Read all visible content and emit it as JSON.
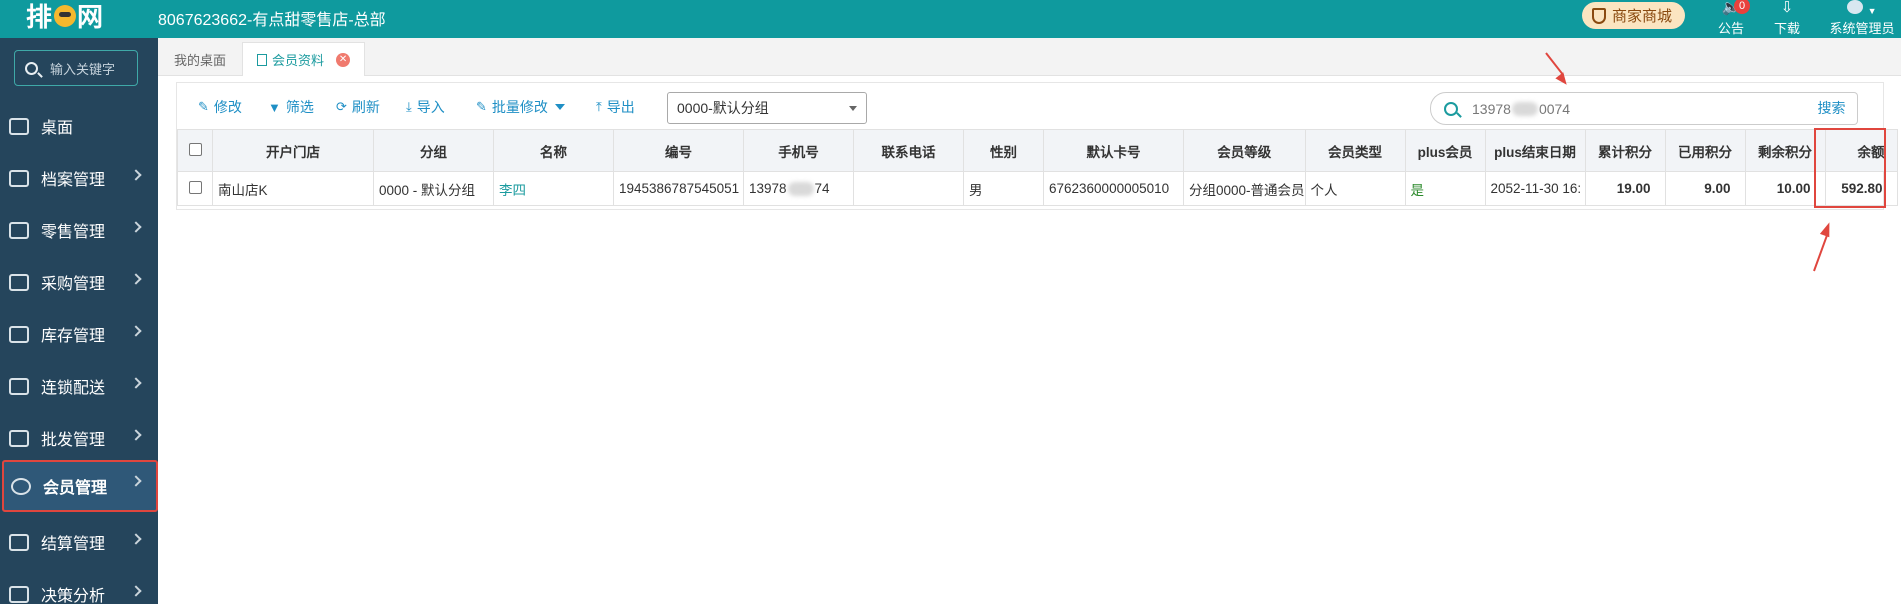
{
  "app": {
    "logo_text": "排队网",
    "store_title": "8067623662-有点甜零售店-总部"
  },
  "topbar": {
    "shop_label": "商家商城",
    "announce_label": "公告",
    "announce_count": "0",
    "download_label": "下载",
    "user_label": "系统管理员"
  },
  "sidebar": {
    "search_placeholder": "输入关键字",
    "items": [
      {
        "label": "桌面",
        "icon": "desktop-icon"
      },
      {
        "label": "档案管理",
        "icon": "archive-icon"
      },
      {
        "label": "零售管理",
        "icon": "store-icon"
      },
      {
        "label": "采购管理",
        "icon": "purchase-icon"
      },
      {
        "label": "库存管理",
        "icon": "inventory-icon"
      },
      {
        "label": "连锁配送",
        "icon": "truck-icon"
      },
      {
        "label": "批发管理",
        "icon": "wholesale-icon"
      },
      {
        "label": "会员管理",
        "icon": "member-icon",
        "active": true
      },
      {
        "label": "结算管理",
        "icon": "settlement-icon"
      },
      {
        "label": "决策分析",
        "icon": "analysis-icon"
      }
    ]
  },
  "tabs": [
    {
      "label": "我的桌面"
    },
    {
      "label": "会员资料",
      "active": true
    }
  ],
  "toolbar": {
    "edit": "修改",
    "filter": "筛选",
    "refresh": "刷新",
    "import": "导入",
    "batch_edit": "批量修改",
    "export": "导出",
    "group_select": "0000-默认分组",
    "search_value_head": "13978",
    "search_value_tail": "0074",
    "search_button": "搜索"
  },
  "table": {
    "columns": [
      "开户门店",
      "分组",
      "名称",
      "编号",
      "手机号",
      "联系电话",
      "性别",
      "默认卡号",
      "会员等级",
      "会员类型",
      "plus会员",
      "plus结束日期",
      "累计积分",
      "已用积分",
      "剩余积分",
      "余额"
    ],
    "row": {
      "store": "南山店K",
      "group": "0000 - 默认分组",
      "name": "李四",
      "code": "1945386787545051",
      "phone_head": "13978",
      "phone_tail": "74",
      "contact": "",
      "gender": "男",
      "card": "6762360000005010",
      "level": "分组0000-普通会员",
      "type": "个人",
      "plus": "是",
      "plus_end": "2052-11-30 16:",
      "total_points": "19.00",
      "used_points": "9.00",
      "remaining_points": "10.00",
      "balance": "592.80"
    }
  },
  "colors": {
    "topbar": "#0f9a9e",
    "sidebar": "#25455c",
    "accent": "#1f8fc5",
    "annotation": "#e0463e"
  }
}
